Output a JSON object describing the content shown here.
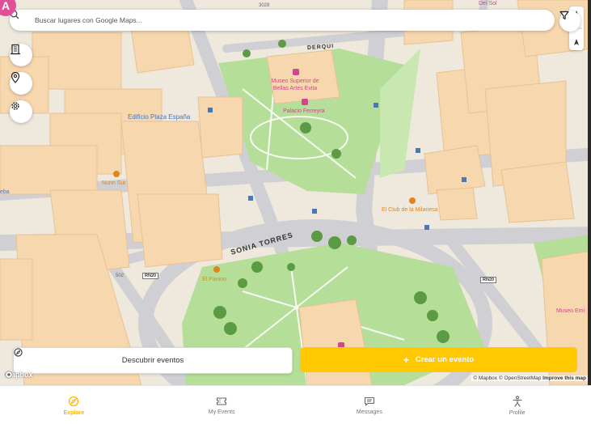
{
  "search": {
    "placeholder": "Buscar lugares con Google Maps..."
  },
  "avatar": {
    "initial": "A"
  },
  "map": {
    "labels": {
      "museum": "Museo Superior de Bellas Artes Evita",
      "palace": "Palacio Ferreyra",
      "edificio": "Edificio Plaza España",
      "nunn": "Nunn Sur",
      "club": "El Club de la Milanesa",
      "paninino": "El Panino",
      "museo_right": "Museo Emi",
      "derqui": "DERQUI",
      "sonia": "SONIA TORRES",
      "route1": "RN20",
      "route2": "RN20",
      "num502": "502",
      "num_top": "3028",
      "del_sol": "Del Sol",
      "left_cut": "eba"
    }
  },
  "buttons": {
    "discover": "Descubrir eventos",
    "create": "Crear un evento",
    "create_symbol": "+"
  },
  "attribution": {
    "logo": "mapbox",
    "mapbox": "© Mapbox",
    "osm": "© OpenStreetMap",
    "improve": "Improve this map"
  },
  "nav": [
    {
      "label": "Explore",
      "icon": "compass-icon"
    },
    {
      "label": "My Events",
      "icon": "ticket-icon"
    },
    {
      "label": "Messages",
      "icon": "message-icon"
    },
    {
      "label": "Profile",
      "icon": "person-icon"
    }
  ],
  "colors": {
    "accent": "#ffc800",
    "pink": "#e24f99",
    "park": "#b7df9a",
    "building": "#f7d6ad",
    "road": "#d6d6da"
  }
}
